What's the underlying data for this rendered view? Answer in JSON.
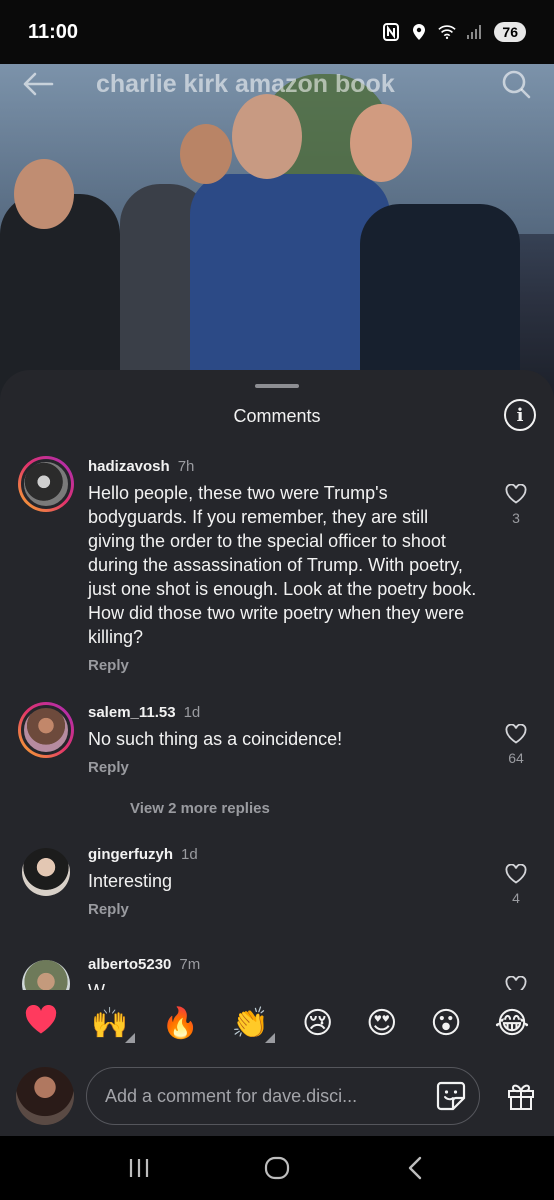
{
  "status": {
    "time": "11:00",
    "battery": "76"
  },
  "header": {
    "title": "charlie kirk amazon book"
  },
  "sheet": {
    "title": "Comments"
  },
  "comments": [
    {
      "username": "hadizavosh",
      "time": "7h",
      "text": "Hello people, these two were Trump's bodyguards. If you remember, they are still giving the order to the special officer to shoot during the assassination of Trump. With poetry, just one shot is enough. Look at the poetry book. How did those two write poetry when they were killing?",
      "reply": "Reply",
      "likes": "3"
    },
    {
      "username": "salem_11.53",
      "time": "1d",
      "text": "No such thing as a coincidence!",
      "reply": "Reply",
      "likes": "64",
      "more_replies": "View 2 more replies"
    },
    {
      "username": "gingerfuzyh",
      "time": "1d",
      "text": "Interesting",
      "reply": "Reply",
      "likes": "4"
    },
    {
      "username": "alberto5230",
      "time": "7m",
      "text": "W..."
    }
  ],
  "emojis": [
    "❤️",
    "🙌",
    "🔥",
    "👏",
    "😢",
    "😍",
    "😮",
    "😂"
  ],
  "compose": {
    "placeholder": "Add a comment for dave.disci..."
  },
  "colors": {
    "sheet_bg": "#25262b",
    "heart": "#ff3a5e",
    "secondary_text": "#9a9ba0"
  }
}
